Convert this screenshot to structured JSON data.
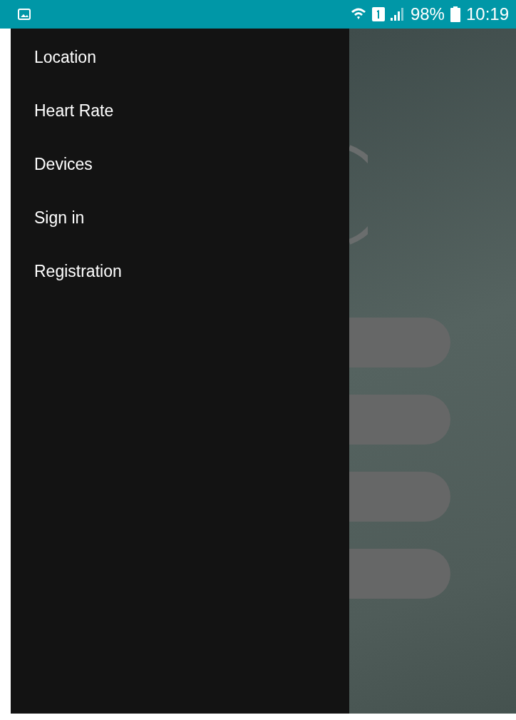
{
  "status_bar": {
    "battery": "98%",
    "time": "10:19"
  },
  "drawer": {
    "items": [
      {
        "label": "Location"
      },
      {
        "label": "Heart Rate"
      },
      {
        "label": "Devices"
      },
      {
        "label": "Sign in"
      },
      {
        "label": "Registration"
      }
    ]
  },
  "background": {
    "buttons": [
      {
        "kind": "pill"
      },
      {
        "kind": "pill"
      },
      {
        "kind": "pill"
      },
      {
        "kind": "pill"
      }
    ]
  }
}
